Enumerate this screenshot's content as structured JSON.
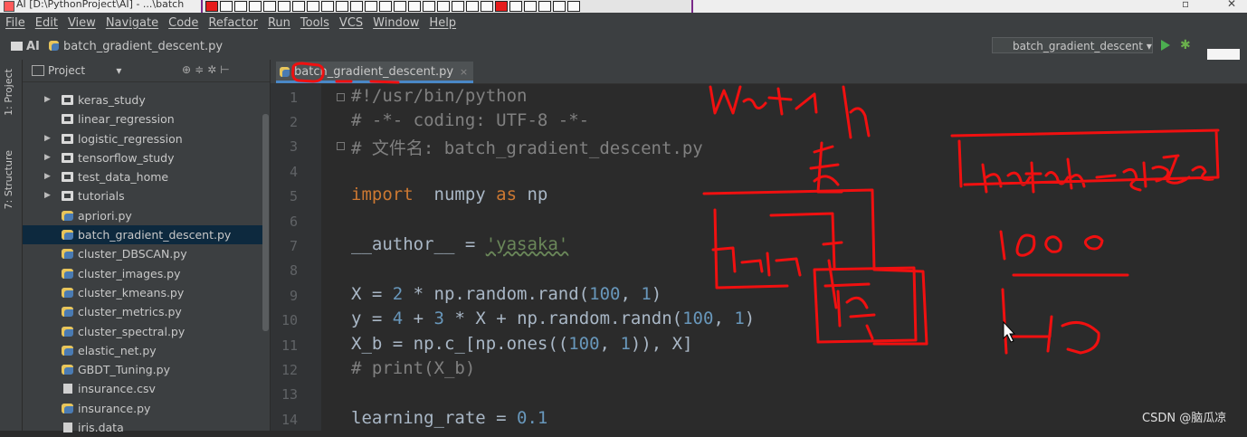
{
  "window": {
    "title": "AI [D:\\PythonProject\\AI] - ...\\batch"
  },
  "menu": [
    "File",
    "Edit",
    "View",
    "Navigate",
    "Code",
    "Refactor",
    "Run",
    "Tools",
    "VCS",
    "Window",
    "Help"
  ],
  "breadcrumb": {
    "project": "AI",
    "file": "batch_gradient_descent.py"
  },
  "run_config": "batch_gradient_descent",
  "left_tabs": [
    "1: Project",
    "7: Structure"
  ],
  "project_panel": {
    "title": "Project",
    "items": [
      {
        "label": "keras_study",
        "type": "folder",
        "arrow": true
      },
      {
        "label": "linear_regression",
        "type": "folder",
        "arrow": false
      },
      {
        "label": "logistic_regression",
        "type": "folder",
        "arrow": true
      },
      {
        "label": "tensorflow_study",
        "type": "folder",
        "arrow": true
      },
      {
        "label": "test_data_home",
        "type": "folder",
        "arrow": true
      },
      {
        "label": "tutorials",
        "type": "folder",
        "arrow": true
      },
      {
        "label": "apriori.py",
        "type": "py"
      },
      {
        "label": "batch_gradient_descent.py",
        "type": "py",
        "selected": true
      },
      {
        "label": "cluster_DBSCAN.py",
        "type": "py"
      },
      {
        "label": "cluster_images.py",
        "type": "py"
      },
      {
        "label": "cluster_kmeans.py",
        "type": "py"
      },
      {
        "label": "cluster_metrics.py",
        "type": "py"
      },
      {
        "label": "cluster_spectral.py",
        "type": "py"
      },
      {
        "label": "elastic_net.py",
        "type": "py"
      },
      {
        "label": "GBDT_Tuning.py",
        "type": "py"
      },
      {
        "label": "insurance.csv",
        "type": "doc"
      },
      {
        "label": "insurance.py",
        "type": "py"
      },
      {
        "label": "iris.data",
        "type": "doc"
      }
    ]
  },
  "editor": {
    "tab": "batch_gradient_descent.py",
    "lines": [
      {
        "n": "1",
        "t": [
          [
            "cm",
            "#!/usr/bin/python"
          ]
        ]
      },
      {
        "n": "2",
        "t": [
          [
            "cm",
            "# -*- coding: UTF-8 -*-"
          ]
        ]
      },
      {
        "n": "3",
        "t": [
          [
            "cm",
            "# 文件名: batch_gradient_descent.py"
          ]
        ]
      },
      {
        "n": "4",
        "t": []
      },
      {
        "n": "5",
        "t": [
          [
            "kw",
            "import"
          ],
          [
            "",
            "  numpy "
          ],
          [
            "kw",
            "as"
          ],
          [
            "",
            " np"
          ]
        ]
      },
      {
        "n": "6",
        "t": []
      },
      {
        "n": "7",
        "t": [
          [
            "",
            "__author__ = "
          ],
          [
            "st",
            "'yasaka'"
          ]
        ]
      },
      {
        "n": "8",
        "t": []
      },
      {
        "n": "9",
        "t": [
          [
            "",
            "X = "
          ],
          [
            "nm",
            "2"
          ],
          [
            "",
            " * np.random.rand("
          ],
          [
            "nm",
            "100"
          ],
          [
            "",
            ", "
          ],
          [
            "nm",
            "1"
          ],
          [
            "",
            ")"
          ]
        ]
      },
      {
        "n": "10",
        "t": [
          [
            "",
            "y = "
          ],
          [
            "nm",
            "4"
          ],
          [
            "",
            " + "
          ],
          [
            "nm",
            "3"
          ],
          [
            "",
            " * X + np.random.randn("
          ],
          [
            "nm",
            "100"
          ],
          [
            "",
            ", "
          ],
          [
            "nm",
            "1"
          ],
          [
            "",
            ")"
          ]
        ]
      },
      {
        "n": "11",
        "t": [
          [
            "",
            "X_b = np.c_[np.ones(("
          ],
          [
            "nm",
            "100"
          ],
          [
            "",
            ", "
          ],
          [
            "nm",
            "1"
          ],
          [
            "",
            ")), X]"
          ]
        ]
      },
      {
        "n": "12",
        "t": [
          [
            "cm",
            "# print(X_b)"
          ]
        ]
      },
      {
        "n": "13",
        "t": []
      },
      {
        "n": "14",
        "t": [
          [
            "",
            "learning_rate = "
          ],
          [
            "nm",
            "0.1"
          ]
        ]
      }
    ]
  },
  "watermark": "CSDN @脑瓜凉"
}
